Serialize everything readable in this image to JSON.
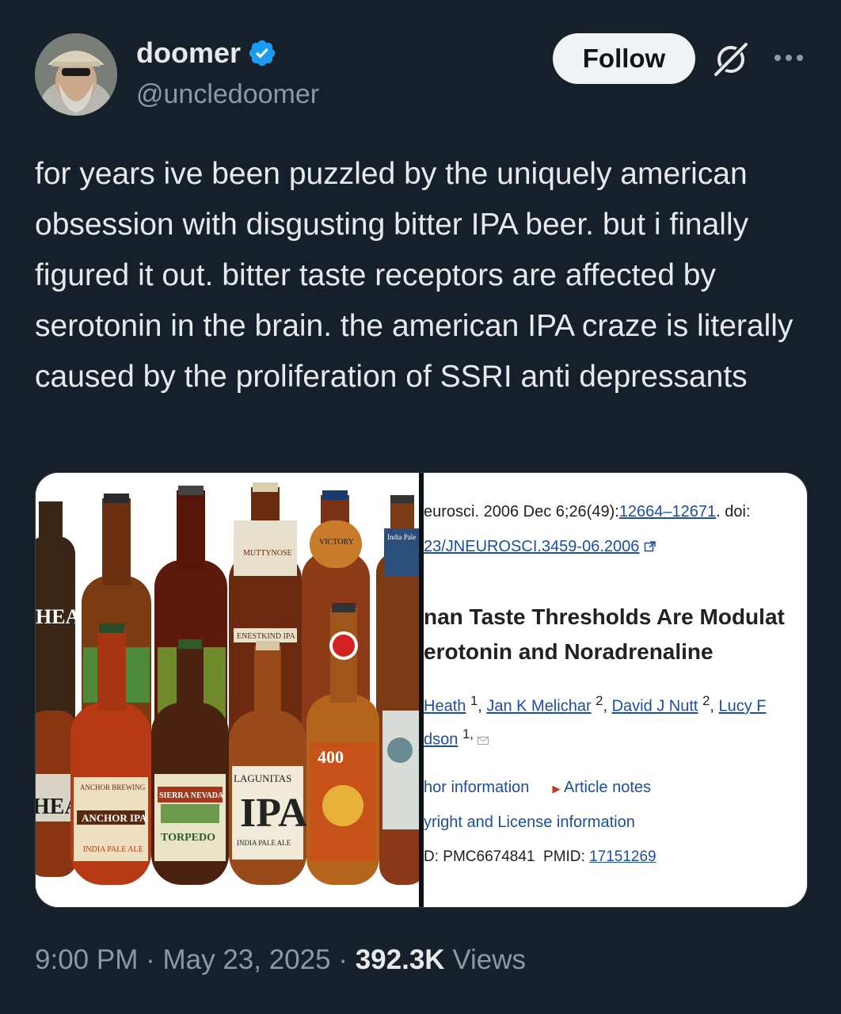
{
  "author": {
    "display_name": "doomer",
    "handle": "@uncledoomer",
    "verified": true
  },
  "actions": {
    "follow_label": "Follow",
    "grok_icon": "grok-icon",
    "more_icon": "more-icon"
  },
  "tweet": {
    "text": "for years ive been puzzled by the uniquely american obsession with disgusting bitter IPA beer. but i finally figured it out. bitter taste receptors are affected by serotonin in the brain. the american IPA craze is literally caused by the proliferation of SSRI anti depressants"
  },
  "media": {
    "beer_labels": {
      "anchor": "ANCHOR IPA",
      "anchor_sub": "INDIA PALE ALE",
      "anchor_brewing": "ANCHOR BREWING",
      "torpedo": "TORPEDO",
      "sierra": "SIERRA NEVADA",
      "lagunitas": "LAGUNITAS",
      "ipa": "IPA",
      "lagunitas_sub": "INDIA PALE ALE",
      "founders_num": "400",
      "victory": "VICTORY",
      "mutty": "MUTTYNOSE",
      "ninkasi": "ENESTKIND IPA",
      "head": "HEA",
      "india_pale": "India Pale"
    },
    "article": {
      "citation_prefix": "eurosci. 2006 Dec 6;26(49):",
      "citation_pages": "12664–12671",
      "citation_suffix": ". doi:",
      "doi": "23/JNEUROSCI.3459-06.2006",
      "title_line1": "nan Taste Thresholds Are Modulat",
      "title_line2": "erotonin and Noradrenaline",
      "author1": "Heath",
      "author2": "Jan K Melichar",
      "author3": "David J Nutt",
      "author4": "Lucy F",
      "author4_cont": "dson",
      "aff1": "1",
      "aff2": "2",
      "aff3": "2",
      "aff4": "1,",
      "author_info": "hor information",
      "article_notes": "Article notes",
      "copyright": "yright and License information",
      "pmcid": "D: PMC6674841",
      "pmid_label": "PMID:",
      "pmid": "17151269"
    }
  },
  "meta": {
    "time": "9:00 PM",
    "date": "May 23, 2025",
    "views_count": "392.3K",
    "views_label": "Views",
    "separator": "·"
  },
  "colors": {
    "background": "#15202b",
    "text": "#e7e9ea",
    "muted": "#8b98a5",
    "verified": "#1d9bf0",
    "link": "#1a4fa3"
  }
}
